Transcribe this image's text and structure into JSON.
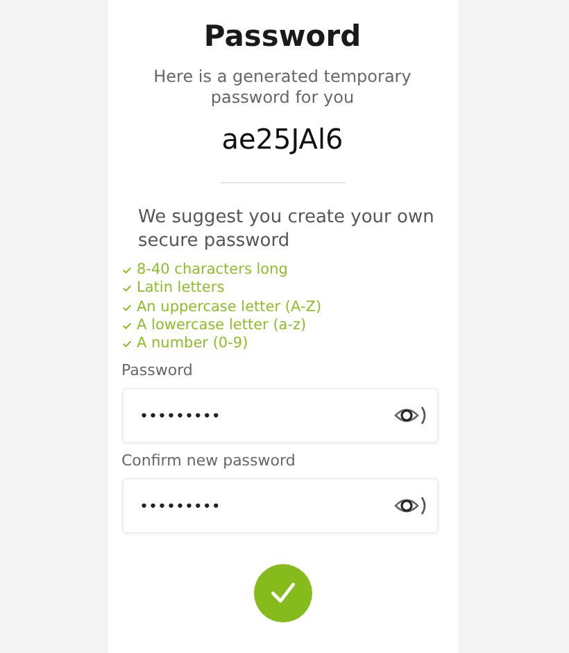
{
  "title": "Password",
  "intro": "Here is a generated temporary password for you",
  "generated_password": "ae25JAl6",
  "suggestion": "We suggest you create your own secure password",
  "requirements": [
    {
      "label": "8-40 characters long",
      "met": true
    },
    {
      "label": "Latin letters",
      "met": true
    },
    {
      "label": "An uppercase letter (A-Z)",
      "met": true
    },
    {
      "label": "A lowercase letter (a-z)",
      "met": true
    },
    {
      "label": "A number (0-9)",
      "met": true
    }
  ],
  "fields": [
    {
      "label": "Password",
      "value": "•••••••••"
    },
    {
      "label": "Confirm new password",
      "value": "•••••••••"
    }
  ]
}
